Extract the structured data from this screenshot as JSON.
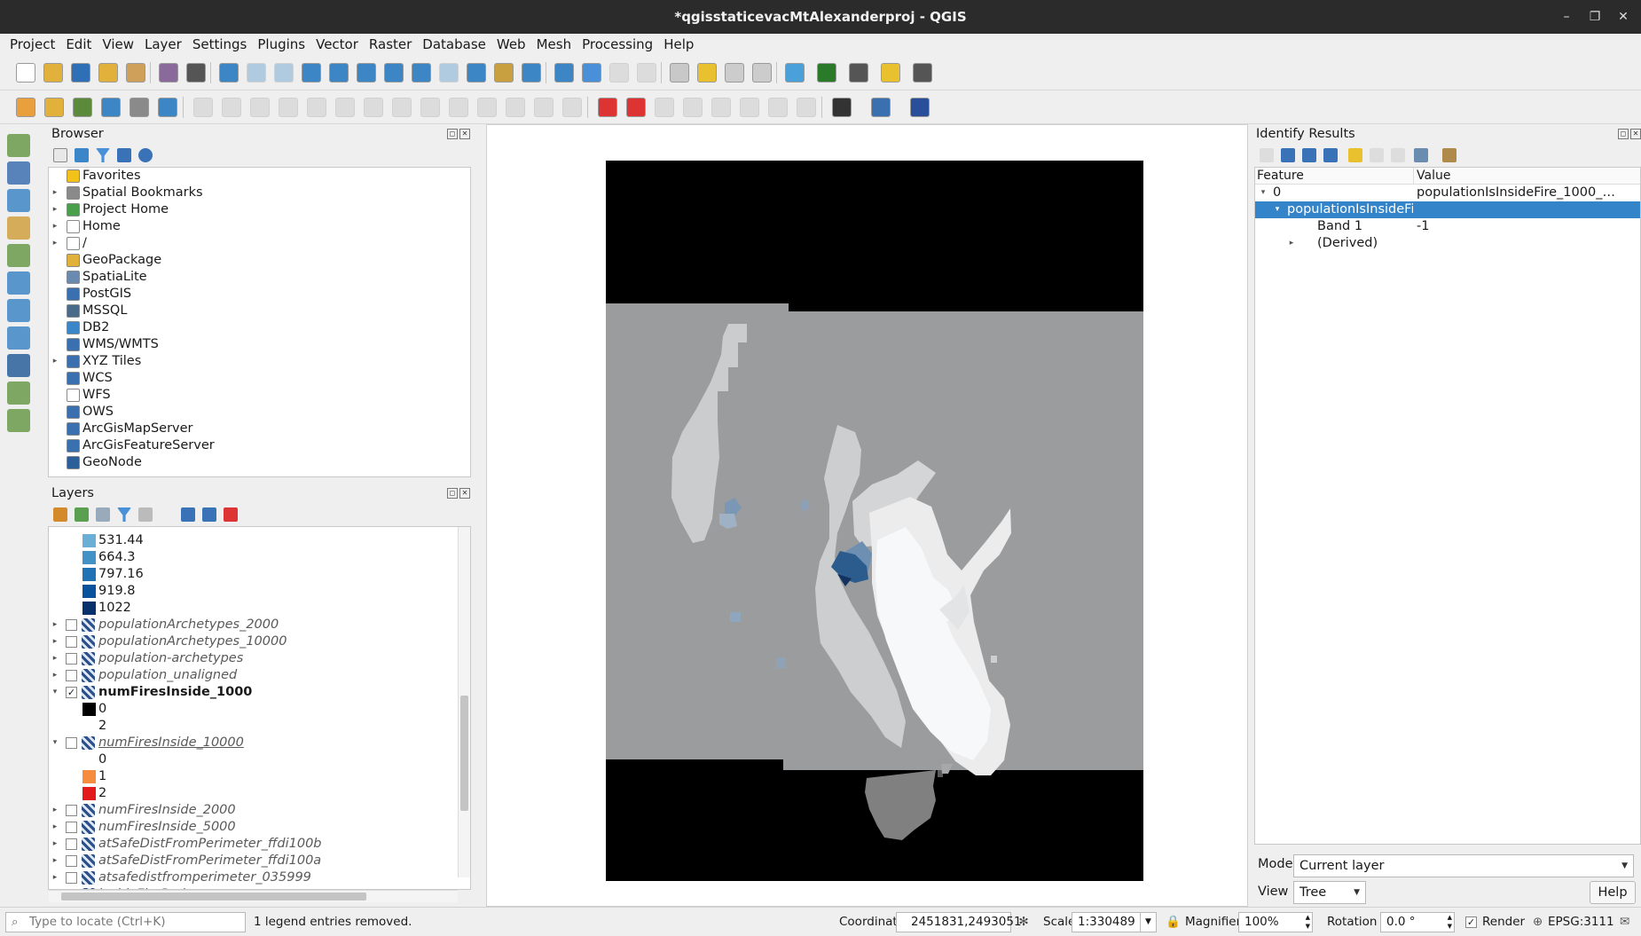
{
  "window": {
    "title": "*qgisstaticevacMtAlexanderproj - QGIS"
  },
  "menu": [
    "Project",
    "Edit",
    "View",
    "Layer",
    "Settings",
    "Plugins",
    "Vector",
    "Raster",
    "Database",
    "Web",
    "Mesh",
    "Processing",
    "Help"
  ],
  "browser": {
    "title": "Browser",
    "items": [
      {
        "label": "Favorites",
        "icon": "star-icon",
        "expand": false
      },
      {
        "label": "Spatial Bookmarks",
        "icon": "bookmark-icon",
        "expand": true
      },
      {
        "label": "Project Home",
        "icon": "project-home-icon",
        "expand": true
      },
      {
        "label": "Home",
        "icon": "home-icon",
        "expand": true
      },
      {
        "label": "/",
        "icon": "folder-icon",
        "expand": true
      },
      {
        "label": "GeoPackage",
        "icon": "geopackage-icon",
        "expand": false
      },
      {
        "label": "SpatiaLite",
        "icon": "spatialite-icon",
        "expand": false
      },
      {
        "label": "PostGIS",
        "icon": "postgis-icon",
        "expand": false
      },
      {
        "label": "MSSQL",
        "icon": "mssql-icon",
        "expand": false
      },
      {
        "label": "DB2",
        "icon": "db2-icon",
        "expand": false
      },
      {
        "label": "WMS/WMTS",
        "icon": "globe-icon",
        "expand": false
      },
      {
        "label": "XYZ Tiles",
        "icon": "xyz-icon",
        "expand": true
      },
      {
        "label": "WCS",
        "icon": "globe-icon",
        "expand": false
      },
      {
        "label": "WFS",
        "icon": "wfs-icon",
        "expand": false
      },
      {
        "label": "OWS",
        "icon": "globe-icon",
        "expand": false
      },
      {
        "label": "ArcGisMapServer",
        "icon": "globe-icon",
        "expand": false
      },
      {
        "label": "ArcGisFeatureServer",
        "icon": "globe-icon",
        "expand": false
      },
      {
        "label": "GeoNode",
        "icon": "geonode-icon",
        "expand": false
      }
    ]
  },
  "layers": {
    "title": "Layers",
    "legend_top": [
      {
        "label": "531.44",
        "color": "#6baed6"
      },
      {
        "label": "664.3",
        "color": "#4292c6"
      },
      {
        "label": "797.16",
        "color": "#2171b5"
      },
      {
        "label": "919.8",
        "color": "#08519c"
      },
      {
        "label": "1022",
        "color": "#08306b"
      }
    ],
    "items": [
      {
        "label": "populationArchetypes_2000",
        "checked": false,
        "style": "ital",
        "expand": "right"
      },
      {
        "label": "populationArchetypes_10000",
        "checked": false,
        "style": "ital",
        "expand": "right"
      },
      {
        "label": "population-archetypes",
        "checked": false,
        "style": "ital",
        "expand": "right"
      },
      {
        "label": "population_unaligned",
        "checked": false,
        "style": "ital",
        "expand": "right"
      },
      {
        "label": "numFiresInside_1000",
        "checked": true,
        "style": "bold",
        "expand": "down"
      },
      {
        "legend": "0",
        "color": "#000000"
      },
      {
        "legend": "2",
        "color": null
      },
      {
        "label": "numFiresInside_10000",
        "checked": false,
        "style": "ital",
        "expand": "down"
      },
      {
        "legend": "0",
        "color": null
      },
      {
        "legend": "1",
        "color": "#f68d3e"
      },
      {
        "legend": "2",
        "color": "#e31a1c"
      },
      {
        "label": "numFiresInside_2000",
        "checked": false,
        "style": "ital",
        "expand": "right"
      },
      {
        "label": "numFiresInside_5000",
        "checked": false,
        "style": "ital",
        "expand": "right"
      },
      {
        "label": "atSafeDistFromPerimeter_ffdi100b",
        "checked": false,
        "style": "ital",
        "expand": "right"
      },
      {
        "label": "atSafeDistFromPerimeter_ffdi100a",
        "checked": false,
        "style": "ital",
        "expand": "right"
      },
      {
        "label": "atsafedistfromperimeter_035999",
        "checked": false,
        "style": "ital",
        "expand": "right"
      },
      {
        "label": "insideFirePerimeters",
        "checked": false,
        "style": "ital",
        "expand": "right"
      }
    ]
  },
  "identify": {
    "title": "Identify Results",
    "col_feature": "Feature",
    "col_value": "Value",
    "rows": [
      {
        "feature": "0",
        "value": "populationIsInsideFire_1000_…",
        "indent": 0,
        "expand": "down",
        "selected": false
      },
      {
        "feature": "populationIsInsideFir…",
        "value": "",
        "indent": 1,
        "expand": "down",
        "selected": true
      },
      {
        "feature": "Band 1",
        "value": "-1",
        "indent": 2,
        "expand": "",
        "selected": false
      },
      {
        "feature": "(Derived)",
        "value": "",
        "indent": 2,
        "expand": "right",
        "selected": false
      }
    ],
    "mode_label": "Mode",
    "mode_value": "Current layer",
    "view_label": "View",
    "view_value": "Tree",
    "help_label": "Help"
  },
  "status": {
    "locate_placeholder": "Type to locate (Ctrl+K)",
    "message": "1 legend entries removed.",
    "coordinate_label": "Coordinate",
    "coordinate_value": "2451831,2493051",
    "scale_label": "Scale",
    "scale_value": "1:330489",
    "magnifier_label": "Magnifier",
    "magnifier_value": "100%",
    "rotation_label": "Rotation",
    "rotation_value": "0.0 °",
    "render_label": "Render",
    "crs": "EPSG:3111"
  }
}
